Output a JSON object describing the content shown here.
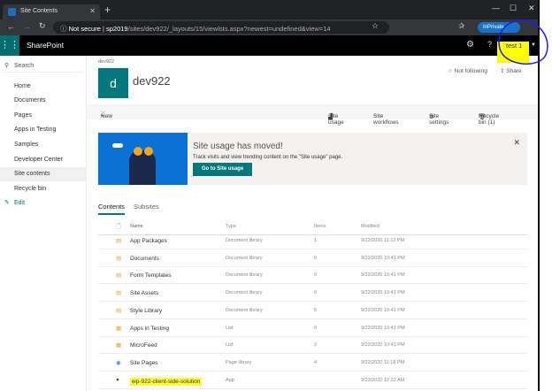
{
  "browser": {
    "tab_title": "Site Contents",
    "url_secure": "Not secure",
    "url_host": "sp2019",
    "url_path": "/sites/dev922/_layouts/15/viewlsts.aspx?newest=undefined&view=14",
    "inprivate": "InPrivate"
  },
  "suite": {
    "app_name": "SharePoint",
    "user": "test 1",
    "help": "?"
  },
  "nav": {
    "search": "Search",
    "items": [
      "Home",
      "Documents",
      "Pages",
      "Apps in Testing",
      "Samples",
      "Developer Center",
      "Site contents",
      "Recycle bin"
    ],
    "edit": "Edit",
    "selected": "Site contents"
  },
  "site": {
    "breadcrumb": "dev922",
    "logo_letter": "d",
    "title": "dev922",
    "follow": "Not following",
    "share": "Share"
  },
  "commands": {
    "new": "New",
    "site_usage": "Site usage",
    "site_workflows": "Site workflows",
    "site_settings": "Site settings",
    "recycle_bin": "Recycle bin (1)"
  },
  "banner": {
    "title": "Site usage has moved!",
    "description": "Track visits and view trending content on the \"Site usage\" page.",
    "button": "Go to Site usage"
  },
  "tabs": {
    "contents": "Contents",
    "subsites": "Subsites",
    "active": "Contents"
  },
  "table": {
    "headers": {
      "name": "Name",
      "type": "Type",
      "items": "Items",
      "modified": "Modified"
    },
    "rows": [
      {
        "icon": "doc-library-icon",
        "name": "App Packages",
        "type": "Document library",
        "items": "1",
        "modified": "9/22/2020 11:12 PM"
      },
      {
        "icon": "doc-library-icon",
        "name": "Documents",
        "type": "Document library",
        "items": "0",
        "modified": "9/22/2020 10:41 PM"
      },
      {
        "icon": "doc-library-icon",
        "name": "Form Templates",
        "type": "Document library",
        "items": "0",
        "modified": "9/22/2020 10:41 PM"
      },
      {
        "icon": "doc-library-icon",
        "name": "Site Assets",
        "type": "Document library",
        "items": "0",
        "modified": "9/22/2020 10:41 PM"
      },
      {
        "icon": "doc-library-icon",
        "name": "Style Library",
        "type": "Document library",
        "items": "5",
        "modified": "9/22/2020 10:41 PM"
      },
      {
        "icon": "list-icon",
        "name": "Apps in Testing",
        "type": "List",
        "items": "0",
        "modified": "9/22/2020 10:41 PM"
      },
      {
        "icon": "list-icon",
        "name": "MicroFeed",
        "type": "List",
        "items": "2",
        "modified": "9/22/2020 10:41 PM"
      },
      {
        "icon": "page-library-icon",
        "name": "Site Pages",
        "type": "Page library",
        "items": "4",
        "modified": "9/22/2020 11:18 PM"
      },
      {
        "icon": "app-icon",
        "name": "wp-922-client-side-solution",
        "type": "App",
        "items": "",
        "modified": "9/23/2020 12:22 AM"
      }
    ]
  },
  "colors": {
    "accent": "#03787c",
    "highlight": "#ffff00",
    "annotation": "#1a1aff"
  }
}
